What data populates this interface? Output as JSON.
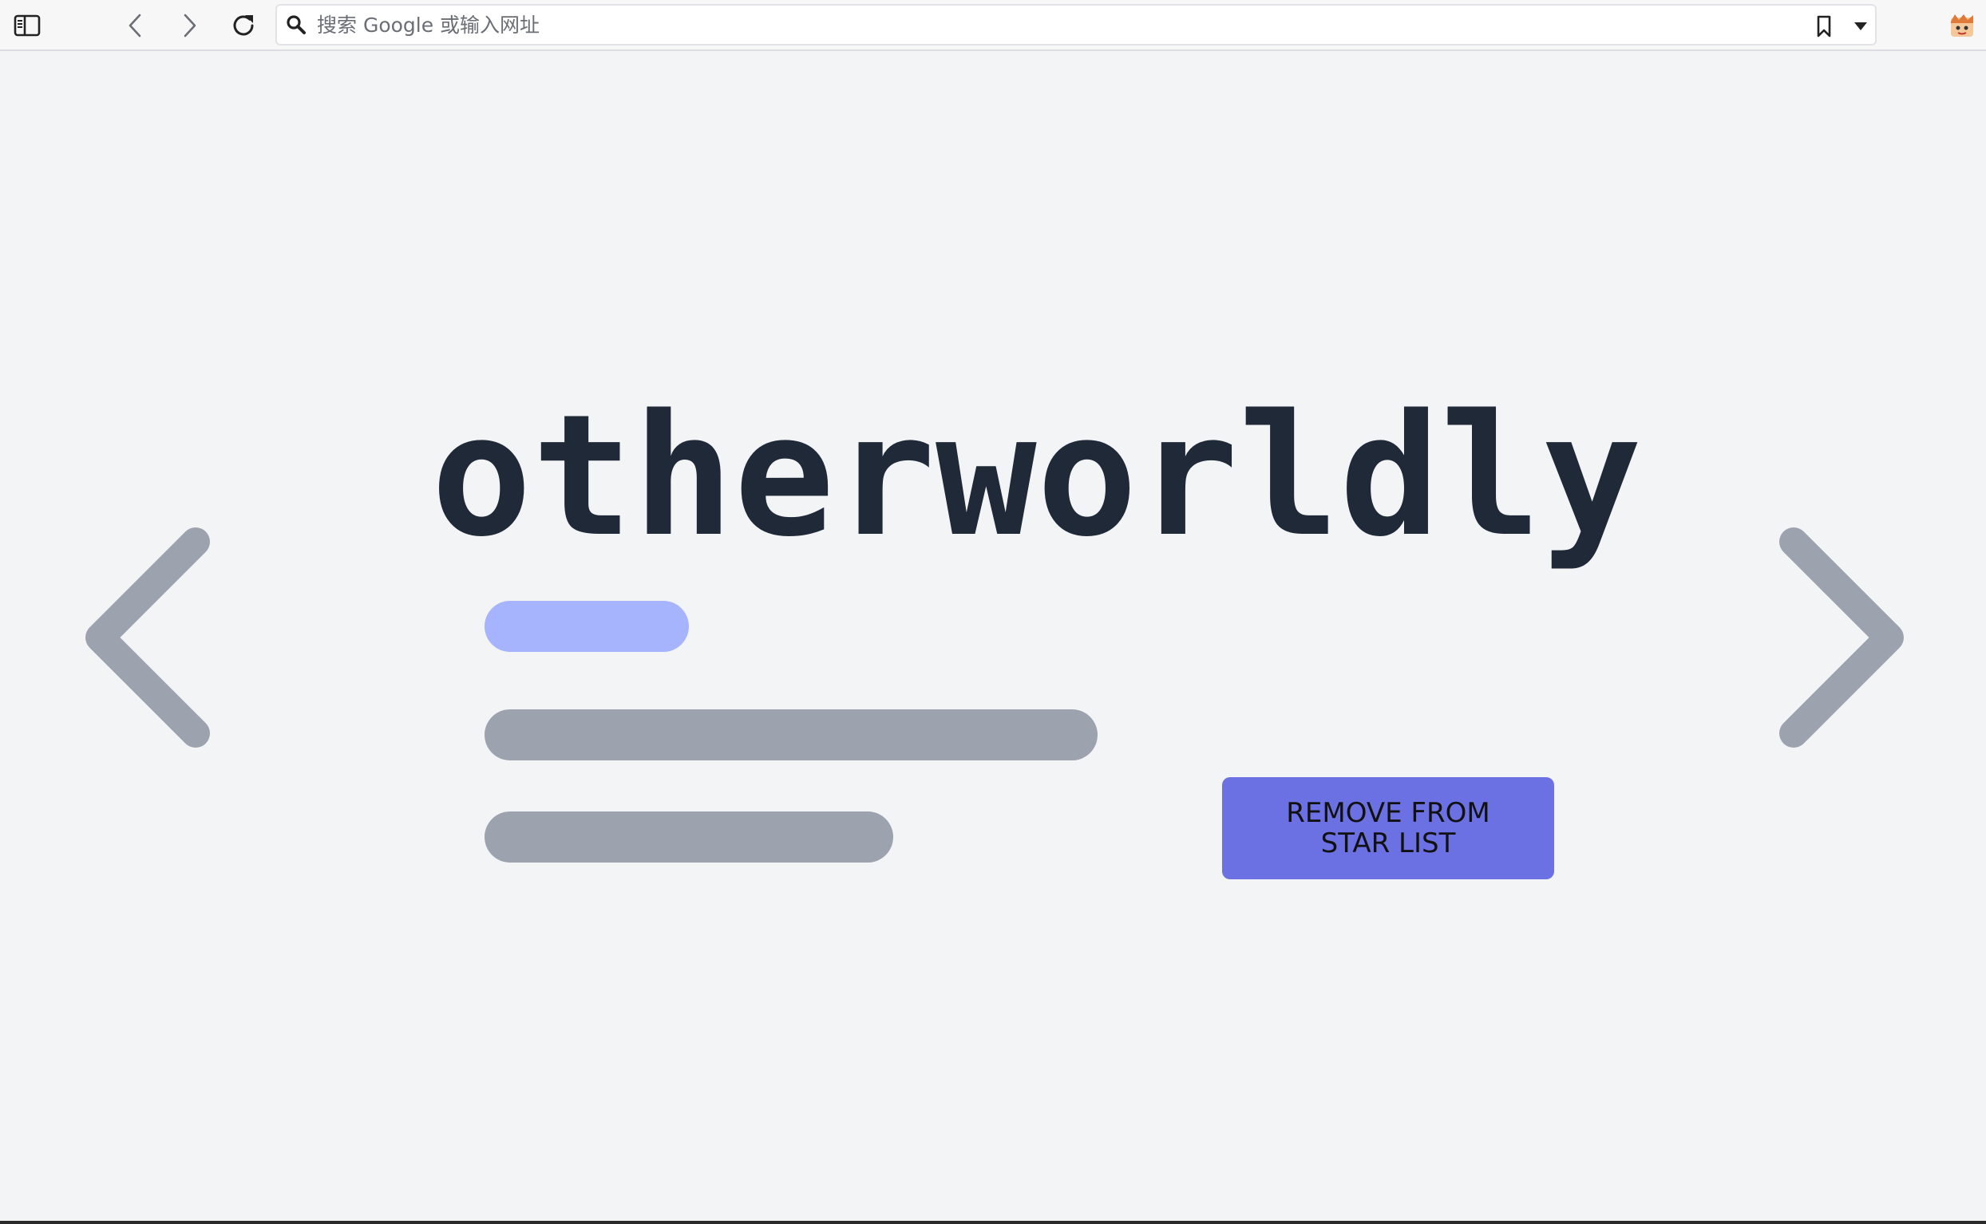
{
  "browser": {
    "address_bar": {
      "placeholder": "搜索 Google 或输入网址",
      "value": ""
    },
    "icons": {
      "sidebar": "sidebar-toggle-icon",
      "back": "chevron-left-icon",
      "forward": "chevron-right-icon",
      "reload": "reload-icon",
      "search": "search-icon",
      "bookmark": "bookmark-icon",
      "dropdown": "caret-down-icon",
      "extension": "extension-avatar-icon"
    }
  },
  "main": {
    "word": "otherworldly",
    "prev_icon": "chevron-left-icon",
    "next_icon": "chevron-right-icon",
    "remove_button_label": "REMOVE FROM STAR LIST"
  },
  "colors": {
    "background": "#f3f4f6",
    "word": "#1f2937",
    "arrow": "#9ca3af",
    "tag_placeholder": "#a5b4fc",
    "line_placeholder": "#9ca3af",
    "button": "#6b70e3"
  }
}
